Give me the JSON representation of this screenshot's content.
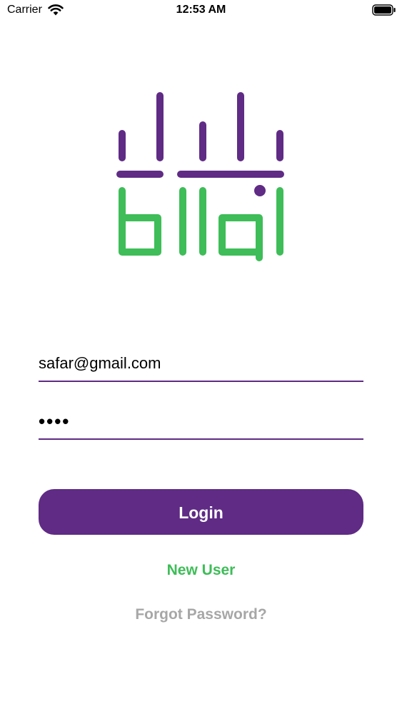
{
  "status_bar": {
    "carrier": "Carrier",
    "time": "12:53 AM"
  },
  "logo": {
    "text": "bilal",
    "colors": {
      "purple": "#5f2b85",
      "green": "#3ebd58"
    }
  },
  "login_form": {
    "email_value": "safar@gmail.com",
    "password_value": "••••",
    "login_label": "Login",
    "new_user_label": "New User",
    "forgot_password_label": "Forgot Password?"
  },
  "colors": {
    "accent": "#5f2b85",
    "green": "#3ebd58",
    "muted": "#a7a7a7"
  }
}
